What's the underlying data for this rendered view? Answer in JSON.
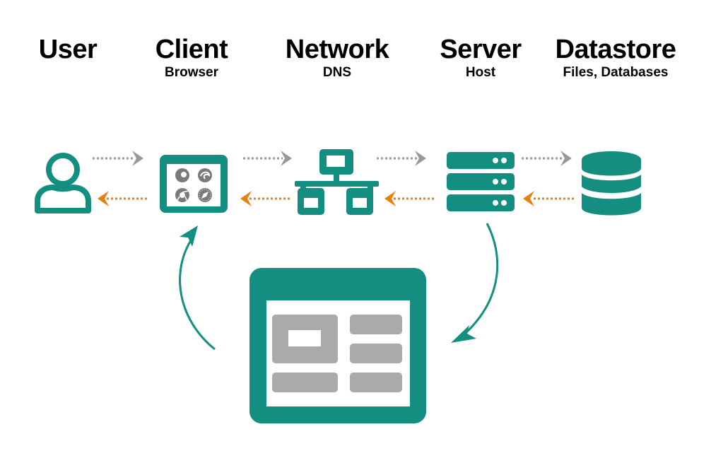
{
  "colors": {
    "teal": "#138e80",
    "gray_icon": "#7a7a7a",
    "gray_block": "#aaaaaa",
    "request_arrow": "#999999",
    "response_arrow": "#e8800e"
  },
  "columns": [
    {
      "id": "user",
      "title": "User",
      "subtitle": "",
      "icon": "user-icon"
    },
    {
      "id": "client",
      "title": "Client",
      "subtitle": "Browser",
      "icon": "browser-window-icon"
    },
    {
      "id": "network",
      "title": "Network",
      "subtitle": "DNS",
      "icon": "network-icon"
    },
    {
      "id": "server",
      "title": "Server",
      "subtitle": "Host",
      "icon": "server-rack-icon"
    },
    {
      "id": "datastore",
      "title": "Datastore",
      "subtitle": "Files, Databases",
      "icon": "database-icon"
    }
  ],
  "flows": {
    "request": {
      "direction": "right",
      "style": "dotted",
      "from_to": [
        [
          "User",
          "Client"
        ],
        [
          "Client",
          "Network"
        ],
        [
          "Network",
          "Server"
        ],
        [
          "Server",
          "Datastore"
        ]
      ]
    },
    "response": {
      "direction": "left",
      "style": "dotted",
      "from_to": [
        [
          "Client",
          "User"
        ],
        [
          "Network",
          "Client"
        ],
        [
          "Server",
          "Network"
        ],
        [
          "Datastore",
          "Server"
        ]
      ]
    }
  },
  "cycle": {
    "center_icon": "web-page-layout-icon",
    "arrows": [
      {
        "from": "Server",
        "to": "Web page",
        "direction": "down"
      },
      {
        "from": "Web page",
        "to": "Client",
        "direction": "up"
      }
    ]
  },
  "browser_icons": [
    "firefox-icon",
    "edge-icon",
    "chrome-icon",
    "safari-icon"
  ]
}
